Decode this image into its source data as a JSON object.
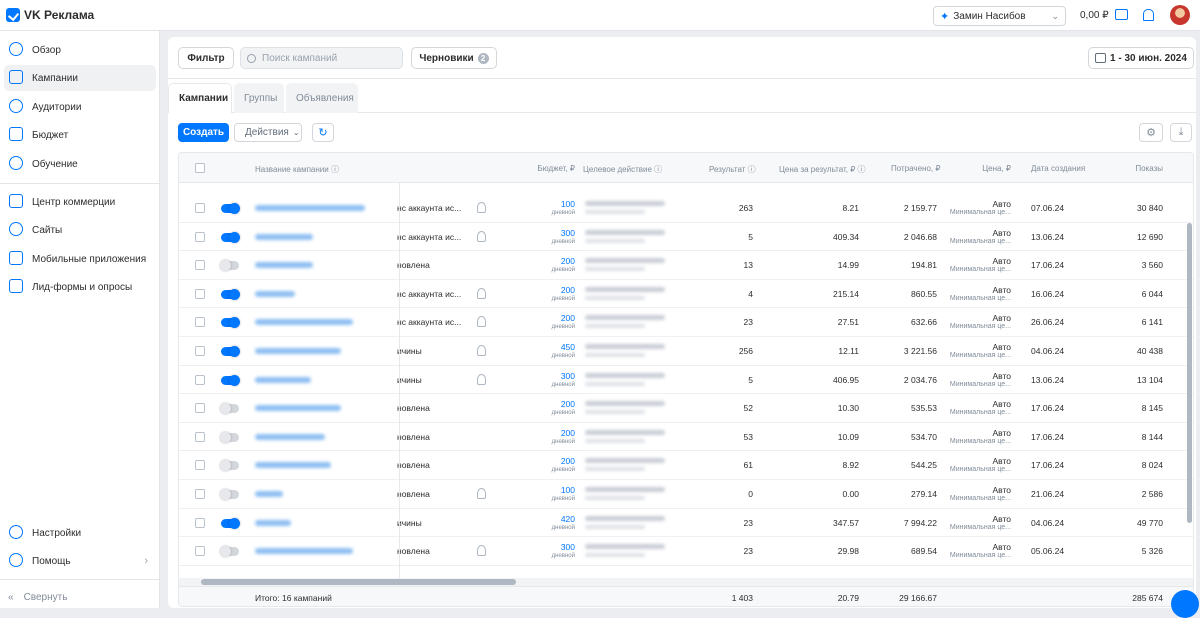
{
  "app": {
    "title": "VK Реклама"
  },
  "header": {
    "account_name": "Замин Насибов",
    "balance": "0,00 ₽"
  },
  "sidebar": {
    "items": [
      {
        "label": "Обзор",
        "icon": "compass-icon"
      },
      {
        "label": "Кампании",
        "icon": "megaphone-icon",
        "active": true
      },
      {
        "label": "Аудитории",
        "icon": "users-icon"
      },
      {
        "label": "Бюджет",
        "icon": "wallet-icon"
      },
      {
        "label": "Обучение",
        "icon": "question-icon"
      },
      {
        "label": "Центр коммерции",
        "icon": "cart-icon"
      },
      {
        "label": "Сайты",
        "icon": "globe-icon"
      },
      {
        "label": "Мобильные приложения",
        "icon": "phone-icon"
      },
      {
        "label": "Лид-формы и опросы",
        "icon": "form-icon"
      }
    ],
    "settings_label": "Настройки",
    "help_label": "Помощь",
    "collapse_label": "Свернуть"
  },
  "toolbar": {
    "filter_label": "Фильтр",
    "search_placeholder": "Поиск кампаний",
    "drafts_label": "Черновики",
    "drafts_count": "2",
    "date_range": "1 - 30 июн. 2024"
  },
  "tabs": [
    {
      "label": "Кампании",
      "active": true
    },
    {
      "label": "Группы"
    },
    {
      "label": "Объявления"
    }
  ],
  "actions": {
    "create_label": "Создать",
    "actions_label": "Действия"
  },
  "table": {
    "columns": {
      "name": "Название кампании",
      "budget": "Бюджет, ₽",
      "goal": "Целевое действие",
      "result": "Результат",
      "cost_per_result": "Цена за результат, ₽",
      "spent": "Потрачено, ₽",
      "price": "Цена, ₽",
      "created": "Дата создания",
      "impressions": "Показы"
    },
    "budget_sub": "дневной",
    "price_sub": "Минимальная це...",
    "rows": [
      {
        "active": true,
        "status": "нс аккаунта ис...",
        "bulb": true,
        "budget": "100",
        "result": "263",
        "cpr": "8.21",
        "spent": "2 159.77",
        "price": "Авто",
        "date": "07.06.24",
        "impressions": "30 840",
        "nw": 110
      },
      {
        "active": true,
        "status": "нс аккаунта ис...",
        "bulb": true,
        "budget": "300",
        "result": "5",
        "cpr": "409.34",
        "spent": "2 046.68",
        "price": "Авто",
        "date": "13.06.24",
        "impressions": "12 690",
        "nw": 58
      },
      {
        "active": false,
        "status": "новлена",
        "bulb": false,
        "budget": "200",
        "result": "13",
        "cpr": "14.99",
        "spent": "194.81",
        "price": "Авто",
        "date": "17.06.24",
        "impressions": "3 560",
        "nw": 58
      },
      {
        "active": true,
        "status": "нс аккаунта ис...",
        "bulb": true,
        "budget": "200",
        "result": "4",
        "cpr": "215.14",
        "spent": "860.55",
        "price": "Авто",
        "date": "16.06.24",
        "impressions": "6 044",
        "nw": 40
      },
      {
        "active": true,
        "status": "нс аккаунта ис...",
        "bulb": true,
        "budget": "200",
        "result": "23",
        "cpr": "27.51",
        "spent": "632.66",
        "price": "Авто",
        "date": "26.06.24",
        "impressions": "6 141",
        "nw": 98
      },
      {
        "active": true,
        "status": "ичины",
        "bulb": true,
        "budget": "450",
        "result": "256",
        "cpr": "12.11",
        "spent": "3 221.56",
        "price": "Авто",
        "date": "04.06.24",
        "impressions": "40 438",
        "nw": 86
      },
      {
        "active": true,
        "status": "ичины",
        "bulb": true,
        "budget": "300",
        "result": "5",
        "cpr": "406.95",
        "spent": "2 034.76",
        "price": "Авто",
        "date": "13.06.24",
        "impressions": "13 104",
        "nw": 56
      },
      {
        "active": false,
        "status": "новлена",
        "bulb": false,
        "budget": "200",
        "result": "52",
        "cpr": "10.30",
        "spent": "535.53",
        "price": "Авто",
        "date": "17.06.24",
        "impressions": "8 145",
        "nw": 86
      },
      {
        "active": false,
        "status": "новлена",
        "bulb": false,
        "budget": "200",
        "result": "53",
        "cpr": "10.09",
        "spent": "534.70",
        "price": "Авто",
        "date": "17.06.24",
        "impressions": "8 144",
        "nw": 70
      },
      {
        "active": false,
        "status": "новлена",
        "bulb": false,
        "budget": "200",
        "result": "61",
        "cpr": "8.92",
        "spent": "544.25",
        "price": "Авто",
        "date": "17.06.24",
        "impressions": "8 024",
        "nw": 76
      },
      {
        "active": false,
        "status": "новлена",
        "bulb": true,
        "budget": "100",
        "result": "0",
        "cpr": "0.00",
        "spent": "279.14",
        "price": "Авто",
        "date": "21.06.24",
        "impressions": "2 586",
        "nw": 28
      },
      {
        "active": true,
        "status": "ичины",
        "bulb": false,
        "budget": "420",
        "result": "23",
        "cpr": "347.57",
        "spent": "7 994.22",
        "price": "Авто",
        "date": "04.06.24",
        "impressions": "49 770",
        "nw": 36
      },
      {
        "active": false,
        "status": "новлена",
        "bulb": true,
        "budget": "300",
        "result": "23",
        "cpr": "29.98",
        "spent": "689.54",
        "price": "Авто",
        "date": "05.06.24",
        "impressions": "5 326",
        "nw": 98
      }
    ],
    "footer": {
      "total_label": "Итого: 16 кампаний",
      "result": "1 403",
      "cpr": "20.79",
      "spent": "29 166.67",
      "impressions": "285 674"
    }
  },
  "colors": {
    "accent": "#0077ff",
    "bg": "#ebedf0"
  }
}
